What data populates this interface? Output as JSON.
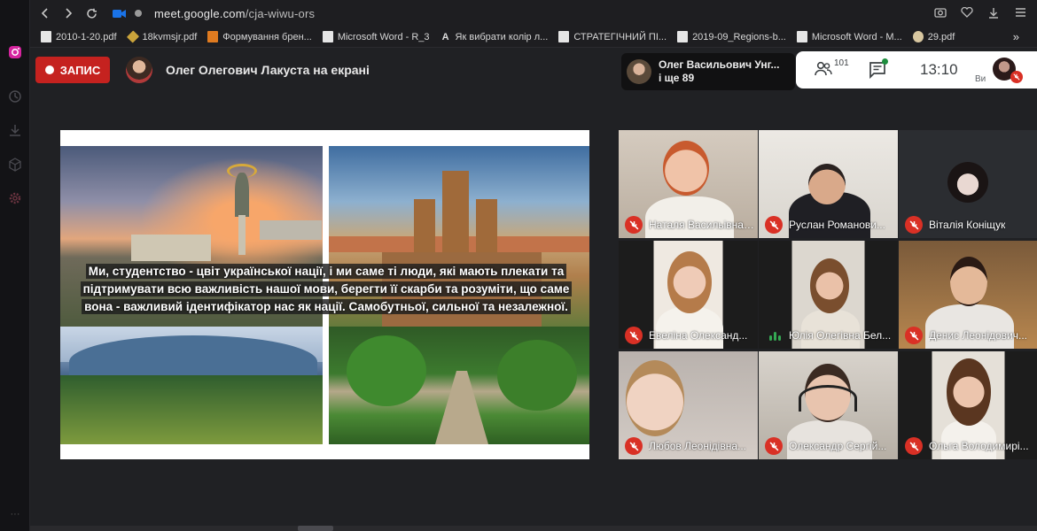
{
  "browser": {
    "url_domain": "meet.google.com",
    "url_path": "/cja-wiwu-ors",
    "bookmarks": [
      {
        "label": "2010-1-20.pdf",
        "icon": "file-icon"
      },
      {
        "label": "18kvmsjr.pdf",
        "icon": "diamond-icon"
      },
      {
        "label": "Формування брен...",
        "icon": "orange-e-icon"
      },
      {
        "label": "Microsoft Word - R_3",
        "icon": "file-icon"
      },
      {
        "label": "Як вибрати колір л...",
        "icon": "letter-a-icon"
      },
      {
        "label": "СТРАТЕГІЧНИЙ ПІ...",
        "icon": "file-icon"
      },
      {
        "label": "2019-09_Regions-b...",
        "icon": "file-icon"
      },
      {
        "label": "Microsoft Word - M...",
        "icon": "file-icon"
      },
      {
        "label": "29.pdf",
        "icon": "round-icon"
      }
    ],
    "bookmarks_more": "»"
  },
  "meet": {
    "record_label": "ЗАПИС",
    "presenter_text": "Олег Олегович Лакуста на екрані",
    "pinned_name": "Олег Васильович Унг...",
    "pinned_more": "і ще 89",
    "people_count": "101",
    "time": "13:10",
    "self_label": "Ви",
    "slide_caption": [
      "Ми, студентство - цвіт української нації, і ми саме ті люди, які мають плекати та",
      "підтримувати всю важливість нашої мови, берегти її скарби та розуміти, що саме",
      "вона - важливий ідентифікатор нас як нації. Самобутньої, сильної та  незалежної."
    ],
    "participants": [
      {
        "name": "Наталя Васильівна ...",
        "muted": true
      },
      {
        "name": "Руслан Романови...",
        "muted": true
      },
      {
        "name": "Віталія Коніщук",
        "muted": true
      },
      {
        "name": "Евеліна Олександ...",
        "muted": true
      },
      {
        "name": "Юлія Олегівна Бел...",
        "muted": false
      },
      {
        "name": "Денис Леонідович...",
        "muted": true
      },
      {
        "name": "Любов Леонідівна...",
        "muted": true
      },
      {
        "name": "Олександр Сергій...",
        "muted": true
      },
      {
        "name": "Ольга Володимирі...",
        "muted": true
      }
    ]
  },
  "colors": {
    "record": "#c5221f",
    "mic_off": "#d93025",
    "speaking": "#34a853"
  }
}
